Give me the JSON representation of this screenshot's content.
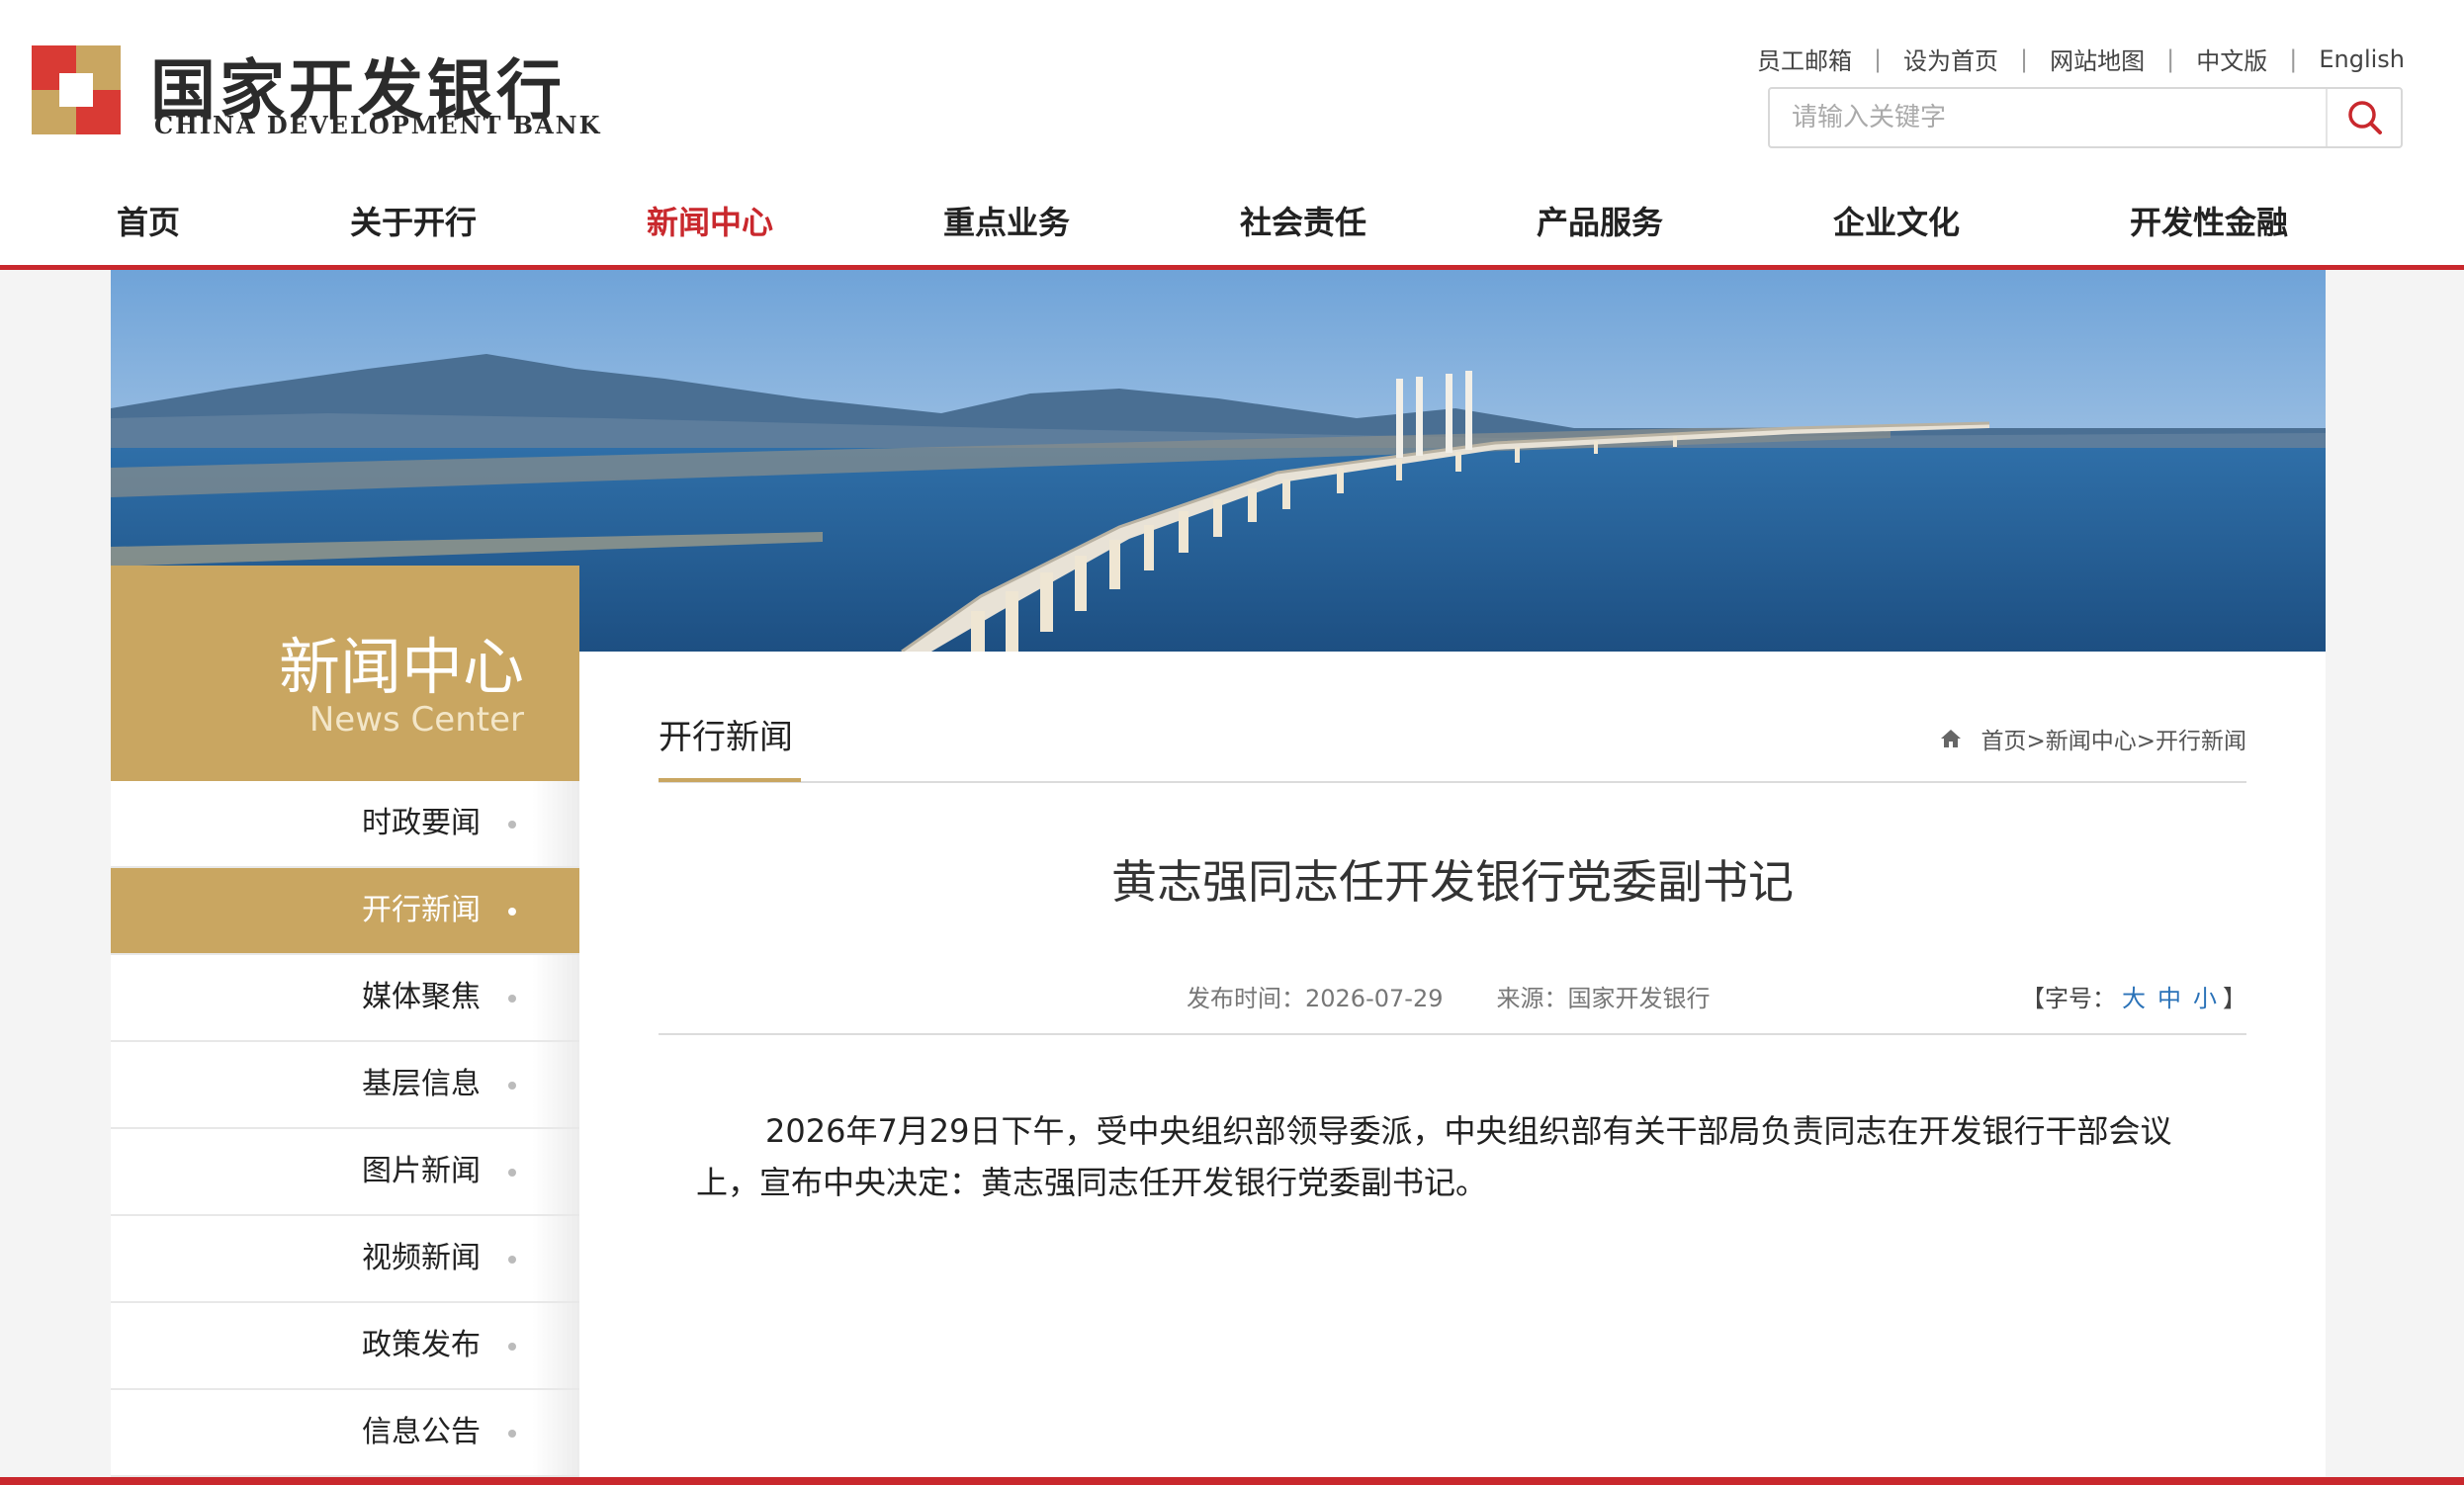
{
  "logo": {
    "name_cn": "国家开发银行",
    "name_en": "CHINA DEVELOPMENT BANK",
    "colors": {
      "red": "#d93a34",
      "gold": "#c9a661"
    }
  },
  "top_links": {
    "staff_mail": "员工邮箱",
    "set_home": "设为首页",
    "site_map": "网站地图",
    "chinese": "中文版",
    "english": "English",
    "separator": "|"
  },
  "search": {
    "placeholder": "请输入关键字",
    "value": "",
    "button_icon": "search-icon"
  },
  "nav": {
    "active_index": 2,
    "items": [
      {
        "label": "首页"
      },
      {
        "label": "关于开行"
      },
      {
        "label": "新闻中心"
      },
      {
        "label": "重点业务"
      },
      {
        "label": "社会责任"
      },
      {
        "label": "产品服务"
      },
      {
        "label": "企业文化"
      },
      {
        "label": "开发性金融"
      }
    ]
  },
  "sidebar": {
    "title_cn": "新闻中心",
    "title_en": "News Center",
    "active_index": 1,
    "items": [
      {
        "label": "时政要闻"
      },
      {
        "label": "开行新闻"
      },
      {
        "label": "媒体聚焦"
      },
      {
        "label": "基层信息"
      },
      {
        "label": "图片新闻"
      },
      {
        "label": "视频新闻"
      },
      {
        "label": "政策发布"
      },
      {
        "label": "信息公告"
      }
    ]
  },
  "section": {
    "title": "开行新闻",
    "breadcrumb": "首页>新闻中心>开行新闻"
  },
  "article": {
    "title": "黄志强同志任开发银行党委副书记",
    "publish_label": "发布时间：",
    "publish_date": "2026-07-29",
    "source_label": "来源：",
    "source": "国家开发银行",
    "font_size_open": "【字号：",
    "font_size_large": "大",
    "font_size_medium": "中",
    "font_size_small": "小",
    "font_size_close": "】",
    "body": "2026年7月29日下午，受中央组织部领导委派，中央组织部有关干部局负责同志在开发银行干部会议上，宣布中央决定：黄志强同志任开发银行党委副书记。"
  },
  "colors": {
    "accent_red": "#c9282d",
    "accent_gold": "#c9a661",
    "link_blue": "#2a72b8"
  }
}
